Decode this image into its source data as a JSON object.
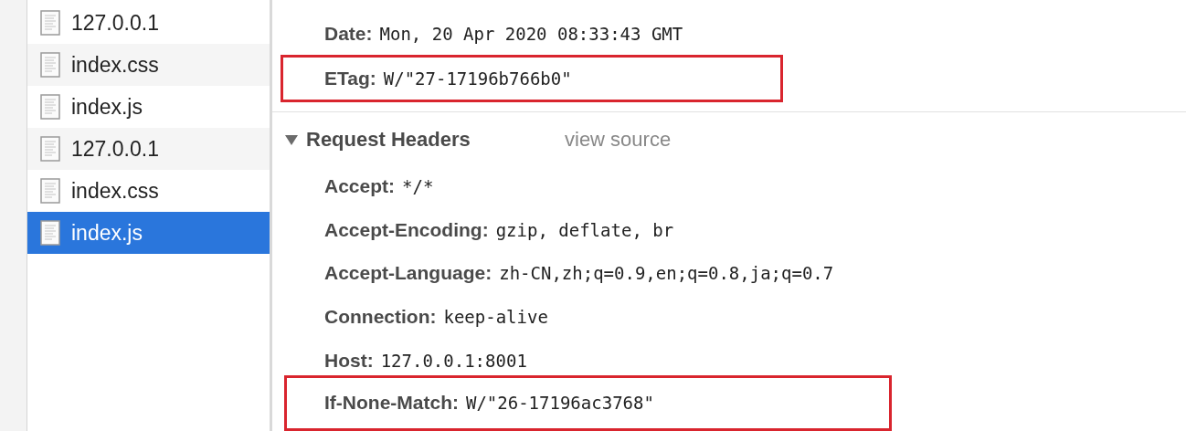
{
  "files": [
    {
      "name": "127.0.0.1",
      "selected": false
    },
    {
      "name": "index.css",
      "selected": false
    },
    {
      "name": "index.js",
      "selected": false
    },
    {
      "name": "127.0.0.1",
      "selected": false
    },
    {
      "name": "index.css",
      "selected": false
    },
    {
      "name": "index.js",
      "selected": true
    }
  ],
  "response_headers": [
    {
      "name": "Date:",
      "value": "Mon, 20 Apr 2020 08:33:43 GMT",
      "highlighted": false
    },
    {
      "name": "ETag:",
      "value": "W/\"27-17196b766b0\"",
      "highlighted": true
    }
  ],
  "request_headers": {
    "title": "Request Headers",
    "expanded": true,
    "view_source": "view source",
    "headers": [
      {
        "name": "Accept:",
        "value": "*/*",
        "highlighted": false
      },
      {
        "name": "Accept-Encoding:",
        "value": "gzip, deflate, br",
        "highlighted": false
      },
      {
        "name": "Accept-Language:",
        "value": "zh-CN,zh;q=0.9,en;q=0.8,ja;q=0.7",
        "highlighted": false
      },
      {
        "name": "Connection:",
        "value": "keep-alive",
        "highlighted": false
      },
      {
        "name": "Host:",
        "value": "127.0.0.1:8001",
        "highlighted": false
      },
      {
        "name": "If-None-Match:",
        "value": "W/\"26-17196ac3768\"",
        "highlighted": true
      }
    ]
  }
}
